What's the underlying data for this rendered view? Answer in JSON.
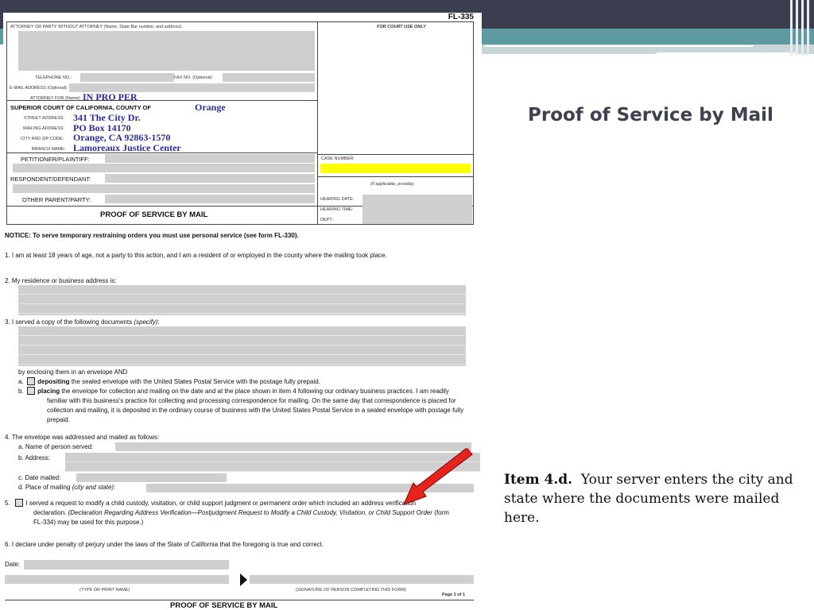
{
  "slide": {
    "title": "Proof of Service by Mail",
    "note_label": "Item 4.d.",
    "note_text": "Your server enters the city and state where the documents were mailed here."
  },
  "form": {
    "form_number": "FL-335",
    "header": {
      "attorney_label": "ATTORNEY OR PARTY WITHOUT ATTORNEY (Name, State Bar number, and address):",
      "court_use_label": "FOR COURT USE ONLY",
      "telephone_label": "TELEPHONE NO.:",
      "fax_label": "FAX NO. (Optional):",
      "email_label": "E-MAIL ADDRESS (Optional):",
      "attorney_for_label": "ATTORNEY FOR (Name):",
      "attorney_for_value": "IN PRO PER",
      "court_label": "SUPERIOR COURT OF CALIFORNIA, COUNTY OF",
      "county_value": "Orange",
      "street_label": "STREET ADDRESS:",
      "street_value": "341 The City Dr.",
      "mailing_label": "MAILING ADDRESS:",
      "mailing_value": "PO Box 14170",
      "city_label": "CITY AND ZIP CODE:",
      "city_value": "Orange, CA  92863-1570",
      "branch_label": "BRANCH NAME:",
      "branch_value": "Lamoreaux Justice Center",
      "petitioner_label": "PETITIONER/PLAINTIFF:",
      "respondent_label": "RESPONDENT/DEFENDANT:",
      "other_parent_label": "OTHER PARENT/PARTY:",
      "case_number_label": "CASE NUMBER:",
      "if_applicable": "(If applicable, provide):",
      "hearing_date_label": "HEARING DATE:",
      "hearing_time_label": "HEARING TIME:",
      "dept_label": "DEPT.:",
      "form_title": "PROOF OF SERVICE BY MAIL"
    },
    "notice": "NOTICE: To serve temporary restraining orders you must use personal service (see form FL-330).",
    "item1": "1.   I am at least 18 years of age, not a party to this action, and I am a resident of or employed in the county where the mailing took place.",
    "item2": "2.   My residence or business address is:",
    "item3": "3.   I served a copy of the following documents",
    "item3_specify": "(specify)",
    "item3_colon": ":",
    "enclosing": "by enclosing them in an envelope AND",
    "item3a_prefix": "a.",
    "item3a_bold": "depositing",
    "item3a_text": "the sealed envelope with the United States Postal Service with the postage fully prepaid.",
    "item3b_prefix": "b.",
    "item3b_bold": "placing",
    "item3b_text": "the envelope for collection and mailing on the date and at the place shown in item 4 following our ordinary business practices. I am readily familiar with this business's practice for collecting and processing correspondence for mailing. On the same day that correspondence is placed for collection and mailing, it is deposited in the ordinary course of business with the United States Postal Service in a sealed envelope with postage fully prepaid.",
    "item4": "4.   The envelope was addressed and mailed as follows:",
    "item4a": "a.   Name of person served:",
    "item4b": "b.   Address:",
    "item4c": "c.   Date mailed:",
    "item4d": "d.   Place of mailing",
    "item4d_italic": "(city and state)",
    "item4d_colon": ":",
    "item5_prefix": "5.",
    "item5_text": "I served a request to modify a child custody, visitation, or child support judgment or permanent order which included an address verification declaration.",
    "item5_italic": "(Declaration Regarding Address Verification—Postjudgment Request to Modify a Child Custody, Visitation, or Child Support Order",
    "item5_tail": "(form FL-334) may be used for this purpose.)",
    "item6": "6.   I declare under penalty of perjury under the laws of the State of California that the foregoing is true and correct.",
    "date_label": "Date:",
    "type_name_label": "(TYPE OR PRINT NAME)",
    "signature_label": "(SIGNATURE OF PERSON COMPLETING THIS FORM)",
    "page_label": "Page 1 of 1",
    "footer_title": "PROOF OF SERVICE BY MAIL"
  },
  "colors": {
    "banner_dark": "#3b3e4f",
    "banner_teal": "#5f9aa0",
    "handwritten_blue": "#2a2aa0",
    "highlight_yellow": "#ffff00",
    "arrow_red": "#e8231e"
  }
}
